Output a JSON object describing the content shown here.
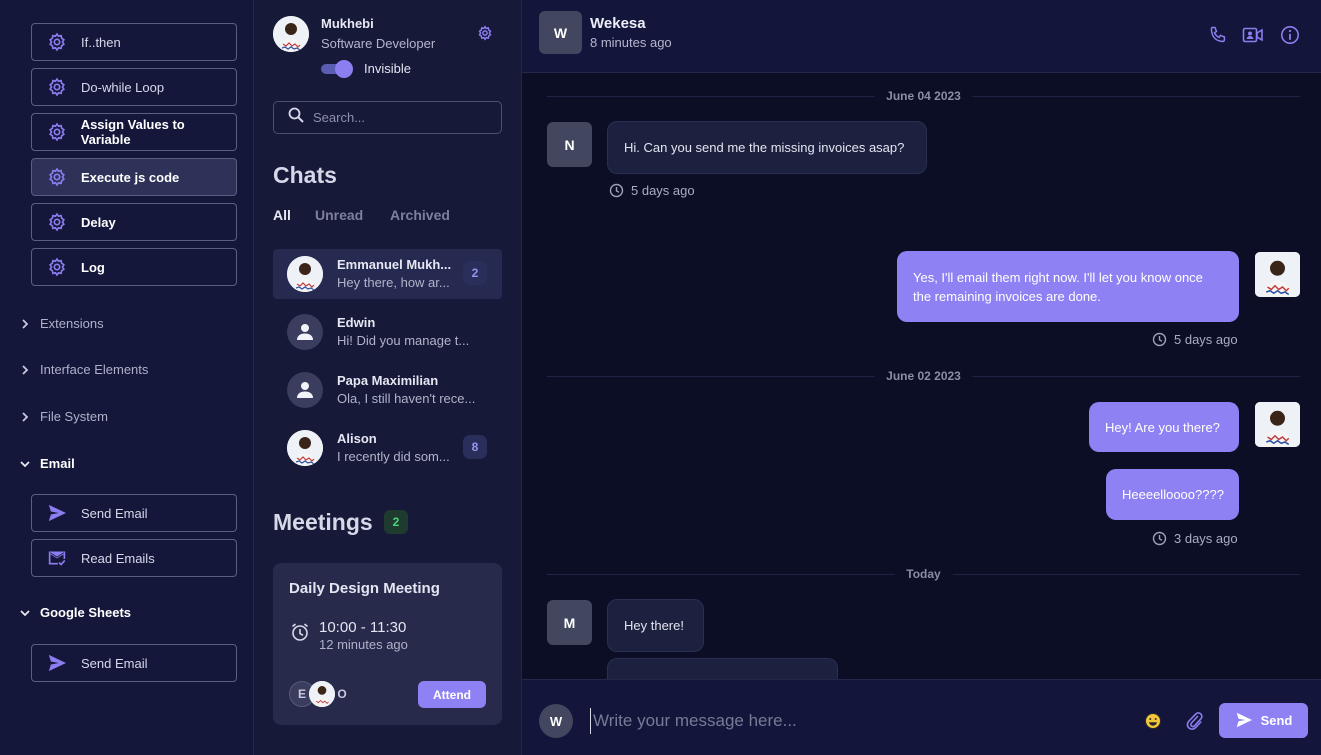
{
  "colors": {
    "accent": "#8e81f3",
    "panel": "#14173a",
    "background": "#0b0e25",
    "badge_green": "#4fd37a"
  },
  "workflow": {
    "items": [
      {
        "label": "If..then",
        "icon": "gear-icon"
      },
      {
        "label": "Do-while Loop",
        "icon": "gear-icon"
      },
      {
        "label": "Assign Values to Variable",
        "icon": "gear-icon"
      },
      {
        "label": "Execute js code",
        "icon": "gear-icon"
      },
      {
        "label": "Delay",
        "icon": "gear-icon"
      },
      {
        "label": "Log",
        "icon": "gear-icon"
      }
    ],
    "sections": [
      {
        "label": "Extensions",
        "expanded": false
      },
      {
        "label": "Interface Elements",
        "expanded": false
      },
      {
        "label": "File System",
        "expanded": false
      },
      {
        "label": "Email",
        "expanded": true,
        "items": [
          {
            "label": "Send Email",
            "icon": "send-icon"
          },
          {
            "label": "Read Emails",
            "icon": "mail-check-icon"
          }
        ]
      },
      {
        "label": "Google Sheets",
        "expanded": true,
        "items": [
          {
            "label": "Send Email",
            "icon": "send-icon"
          }
        ]
      }
    ]
  },
  "profile": {
    "name": "Mukhebi",
    "role": "Software Developer",
    "status_label": "Invisible"
  },
  "search": {
    "placeholder": "Search..."
  },
  "chats": {
    "title": "Chats",
    "tabs": [
      "All",
      "Unread",
      "Archived"
    ],
    "items": [
      {
        "name": "Emmanuel Mukh...",
        "preview": "Hey there, how ar...",
        "badge": "2"
      },
      {
        "name": "Edwin",
        "preview": "Hi! Did you manage t...",
        "badge": ""
      },
      {
        "name": "Papa Maximilian",
        "preview": "Ola, I still haven't rece...",
        "badge": ""
      },
      {
        "name": "Alison",
        "preview": "I recently did som...",
        "badge": "8"
      }
    ]
  },
  "meetings": {
    "title": "Meetings",
    "count": "2",
    "card": {
      "title": "Daily Design Meeting",
      "time": "10:00 - 11:30",
      "ago": "12 minutes ago",
      "participants": [
        "E",
        "",
        "O"
      ],
      "attend_label": "Attend"
    }
  },
  "conversation": {
    "contact_initial": "W",
    "contact_name": "Wekesa",
    "last_seen": "8 minutes ago",
    "dividers": [
      "June 04 2023",
      "June 02 2023",
      "Today"
    ],
    "messages": [
      {
        "sender_initial": "N",
        "text": "Hi. Can you send me the missing invoices asap?",
        "time": "5 days ago"
      },
      {
        "text": "Yes, I'll email them right now. I'll let you know once the remaining invoices are done.",
        "time": "5 days ago"
      },
      {
        "text": "Hey! Are you there?"
      },
      {
        "text": "Heeeelloooo????",
        "time": "3 days ago"
      },
      {
        "sender_initial": "M",
        "text": "Hey there!"
      }
    ]
  },
  "composer": {
    "avatar_initial": "W",
    "placeholder": "Write your message here...",
    "send_label": "Send"
  }
}
